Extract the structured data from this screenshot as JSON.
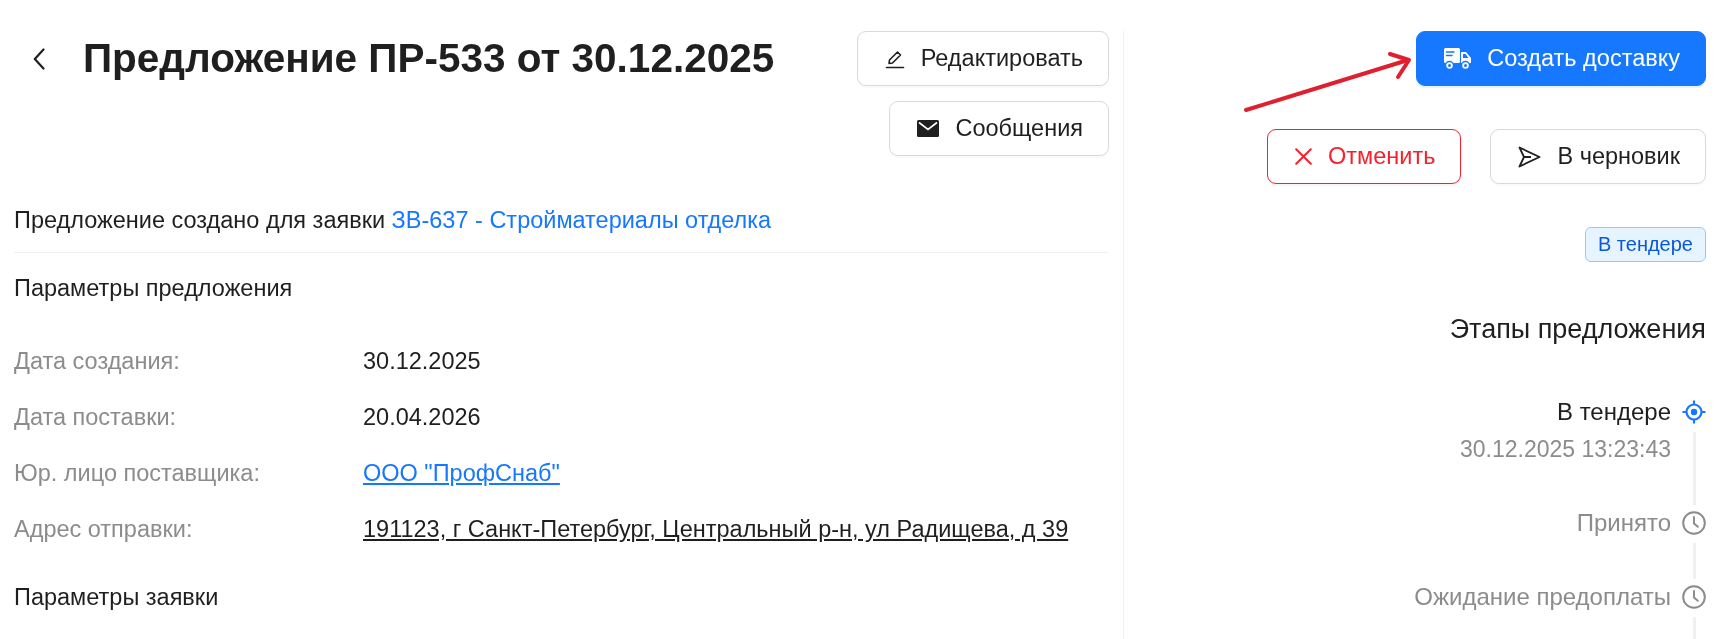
{
  "header": {
    "title": "Предложение ПР-533 от 30.12.2025"
  },
  "header_actions": [
    {
      "kind": "edit",
      "label": "Редактировать"
    },
    {
      "kind": "messages",
      "label": "Сообщения"
    }
  ],
  "source_note": {
    "text": "Предложение создано для заявки",
    "link": "ЗВ-637 - Стройматериалы отделка"
  },
  "offer_params": {
    "title": "Параметры предложения",
    "fields": [
      {
        "label": "Дата создания:",
        "value": "30.12.2025",
        "kind": "text"
      },
      {
        "label": "Дата поставки:",
        "value": "20.04.2026",
        "kind": "text"
      },
      {
        "label": "Юр. лицо поставщика:",
        "value": "ООО \"ПрофСнаб\"",
        "kind": "link"
      },
      {
        "label": "Адрес отправки:",
        "value": "191123, г Санкт-Петербург, Центральный р-н, ул Радищева, д 39",
        "kind": "address"
      }
    ]
  },
  "request_params": {
    "title": "Параметры заявки"
  },
  "primary_action": {
    "label": "Создать доставку"
  },
  "actions": [
    {
      "kind": "cancel",
      "label": "Отменить"
    },
    {
      "kind": "draft",
      "label": "В черновик"
    }
  ],
  "status_tag": {
    "label": "В тендере"
  },
  "stages": {
    "title": "Этапы предложения",
    "items": [
      {
        "label": "В тендере",
        "time": "30.12.2025 13:23:43",
        "active": true
      },
      {
        "label": "Принято",
        "active": false
      },
      {
        "label": "Ожидание предоплаты",
        "active": false
      }
    ]
  }
}
